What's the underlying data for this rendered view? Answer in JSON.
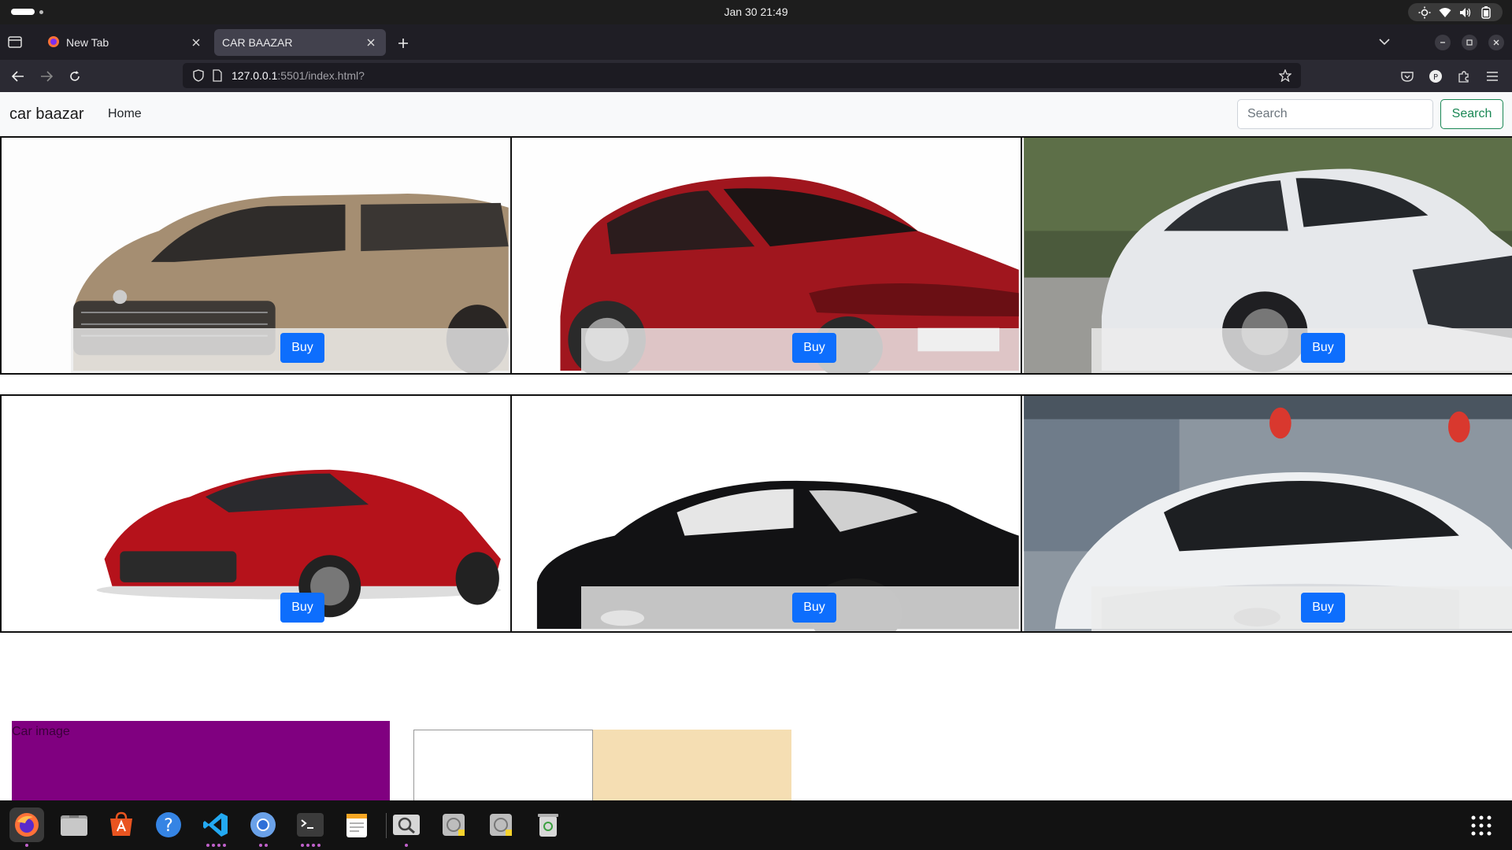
{
  "system": {
    "clock": "Jan 30  21:49"
  },
  "browser": {
    "tabs": [
      {
        "label": "New Tab",
        "active": false
      },
      {
        "label": "CAR BAAZAR",
        "active": true
      }
    ],
    "url_host": "127.0.0.1",
    "url_rest": ":5501/index.html?"
  },
  "site": {
    "brand": "car baazar",
    "nav": {
      "home": "Home"
    },
    "search": {
      "placeholder": "Search",
      "button": "Search"
    },
    "cards": [
      {
        "buy": "Buy",
        "image": "beige-minivan"
      },
      {
        "buy": "Buy",
        "image": "red-hatchback"
      },
      {
        "buy": "Buy",
        "image": "white-sedan"
      },
      {
        "buy": "Buy",
        "image": "red-sports-car"
      },
      {
        "buy": "Buy",
        "image": "black-sports-car"
      },
      {
        "buy": "Buy",
        "image": "white-sedan-front"
      }
    ],
    "car_image_label": "Car image",
    "colors": {
      "purple": "#800080",
      "wheat": "#f5deb3",
      "buy": "#0d6efd",
      "search_outline": "#198754"
    }
  },
  "dock": {
    "apps": [
      "firefox-icon",
      "files-icon",
      "app-center-icon",
      "help-icon",
      "vscode-icon",
      "chromium-icon",
      "terminal-icon",
      "text-editor-icon",
      "image-viewer-icon",
      "disk-icon",
      "disk-alt-icon",
      "trash-icon",
      "show-apps-icon"
    ]
  }
}
